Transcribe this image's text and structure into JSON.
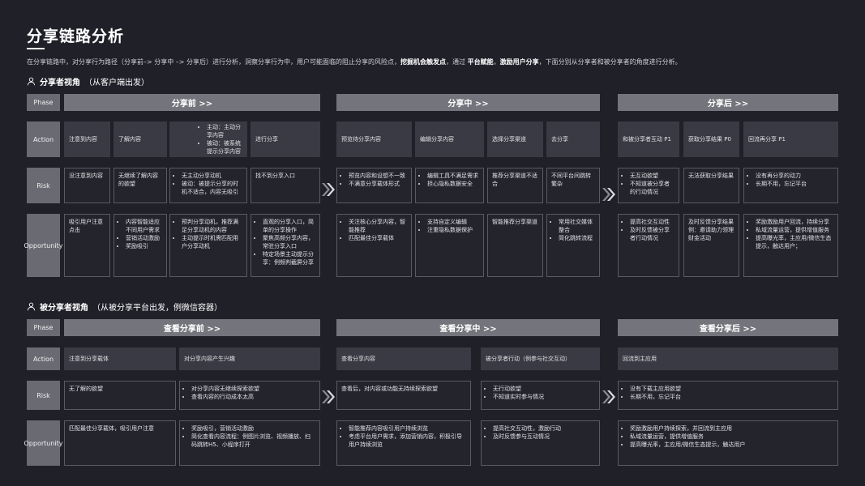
{
  "page": {
    "title": "分享链路分析",
    "intro_parts": [
      {
        "text": "在分享链路中，对分享行为路径（分享前–> 分享中 –> 分享后）进行分析，洞察分享行为中，用户可能面临的阻止分享的风险点，",
        "bold": false
      },
      {
        "text": "挖掘机会触发点",
        "bold": true
      },
      {
        "text": "，通过 ",
        "bold": false
      },
      {
        "text": "平台赋能",
        "bold": true
      },
      {
        "text": "，",
        "bold": false
      },
      {
        "text": "激励用户分享",
        "bold": true
      },
      {
        "text": "，下面分别从分享者和被分享者的角度进行分析。",
        "bold": false
      }
    ]
  },
  "row_labels": {
    "phase": "Phase",
    "action": "Action",
    "risk": "Risk",
    "opportunity": "Opportunity"
  },
  "sharer": {
    "title_bold": "分享者视角",
    "title_rest": "（从客户端出发）",
    "phases": [
      "分享前 >>",
      "分享中 >>",
      "分享后 >>"
    ],
    "actions": [
      [
        "注意到内容"
      ],
      [
        "了解内容"
      ],
      [
        "主动：主动分享内容",
        "被动：被系统提示分享内容"
      ],
      [
        "进行分享"
      ],
      [
        "预览待分享内容"
      ],
      [
        "编辑分享内容"
      ],
      [
        "选择分享渠道"
      ],
      [
        "去分享"
      ],
      [
        "和被分享者互动 P1"
      ],
      [
        "获取分享结果 P0"
      ],
      [
        "回流再分享 P1"
      ]
    ],
    "risks": [
      [
        "没注意到内容"
      ],
      [
        "无继续了解内容的欲望"
      ],
      [
        "无主动分享动机",
        "被动：被提示分享的时机不适合，内容无吸引"
      ],
      [
        "找不到分享入口"
      ],
      [
        "预览内容和设想不一致",
        "不满意分享载体形式"
      ],
      [
        "编辑工具不满足需求",
        "担心隐私数据安全"
      ],
      [
        "推荐分享渠道不适合"
      ],
      [
        "不同平台间跳转繁杂"
      ],
      [
        "无互动欲望",
        "不知道被分享者的行动情况"
      ],
      [
        "无法获取分享结果"
      ],
      [
        "没有再分享的动力",
        "长期不用，忘记平台"
      ]
    ],
    "opportunities": [
      [
        "吸引用户注意点击"
      ],
      [
        "内容智能适应不同用户需求",
        "营销活动激励",
        "奖励吸引"
      ],
      [
        "预判分享动机，推荐满足分享动机的内容",
        "主动提示时机需匹配用户分享动机"
      ],
      [
        "直观的分享入口，简单的分享操作",
        "聚焦高频分享内容，常驻分享入口",
        "特定场景主动提示分享：例频判截屏分享"
      ],
      [
        "关注核心分享内容，智能推荐",
        "匹配最佳分享载体"
      ],
      [
        "支持自定义编辑",
        "注重隐私数据保护"
      ],
      [
        "智能推荐分享渠道"
      ],
      [
        "常用社交媒体整合",
        "简化跳转流程"
      ],
      [
        "提高社交互动性",
        "及时反馈被分享者行动情况"
      ],
      [
        "及时反馈分享结果例：邀请助力领理财金活动"
      ],
      [
        "奖励激励用户回流，持续分享",
        "私域流量运营，提供增值服务",
        "提高曝光率，主应用/微信生态提示，触达用户；"
      ]
    ]
  },
  "receiver": {
    "title_bold": "被分享者视角",
    "title_rest": "（从被分享平台出发，例微信容器）",
    "phases": [
      "查看分享前 >>",
      "查看分享中 >>",
      "查看分享后 >>"
    ],
    "actions": [
      [
        "注意到分享载体"
      ],
      [
        "对分享内容产生兴趣"
      ],
      [
        "查看分享内容"
      ],
      [
        "被分享者行动（例参与社交互动）"
      ],
      [
        "回流到主应用"
      ]
    ],
    "risks": [
      [
        "无了解的欲望"
      ],
      [
        "对分享内容无继续探索欲望",
        "查看内容的行动成本太高"
      ],
      [
        "查看后，对内容或功能无持续探索欲望"
      ],
      [
        "无行动欲望",
        "不知道实时参与情况"
      ],
      [
        "没有下载主应用欲望",
        "长期不用，忘记平台"
      ]
    ],
    "opportunities": [
      [
        "匹配最佳分享载体，吸引用户注意"
      ],
      [
        "奖励吸引，营销活动激励",
        "简化查看内容流程：例图片浏览、视频播放、扫码跳转H5、小程序打开"
      ],
      [
        "智能推荐内容吸引用户持续浏览",
        "考虑平台用户需求，添加营销内容，积极引导用户持续浏览"
      ],
      [
        "提高社交互动性，激励行动",
        "及时反馈参与互动情况"
      ],
      [
        "奖励激励用户持续探索，并回流到主应用",
        "私域流量运营，提供增值服务",
        "提高曝光率，主应用/微信生态提示，触达用户"
      ]
    ]
  }
}
